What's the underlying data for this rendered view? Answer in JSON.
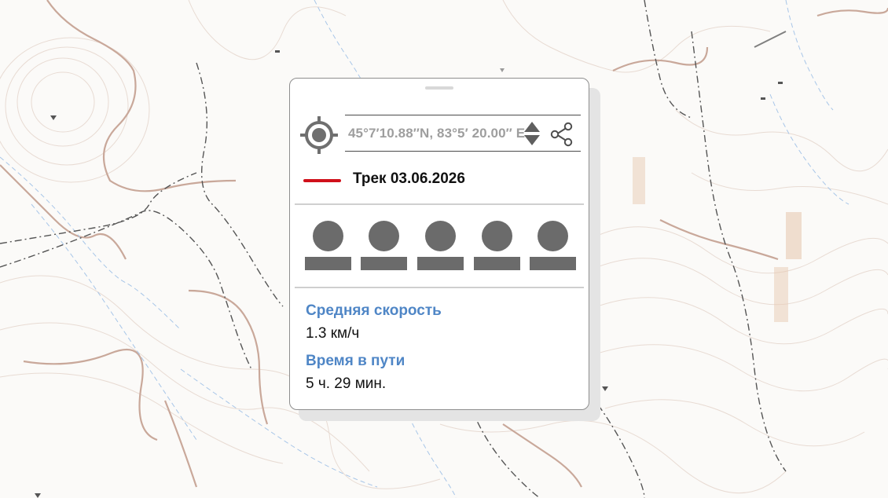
{
  "location": {
    "coordinates": "45°7′10.88″N,  83°5′ 20.00″ E"
  },
  "track": {
    "name": "Трек 03.06.2026",
    "color": "#d0101a"
  },
  "actions": [
    {
      "name": "action-1"
    },
    {
      "name": "action-2"
    },
    {
      "name": "action-3"
    },
    {
      "name": "action-4"
    },
    {
      "name": "action-5"
    }
  ],
  "stats": {
    "avg_speed_label": "Средняя скорость",
    "avg_speed_value": "1.3 км/ч",
    "travel_time_label": "Время в пути",
    "travel_time_value": "5 ч. 29 мин."
  },
  "icons": {
    "locate": "crosshair-target-icon",
    "sort": "up-down-arrows-icon",
    "share": "share-icon"
  },
  "colors": {
    "accent_label": "#4f86c6",
    "contour_major": "#c9a89a",
    "contour_minor": "#e6d6cd",
    "trail": "#555555",
    "stream": "#a8c6e8"
  }
}
